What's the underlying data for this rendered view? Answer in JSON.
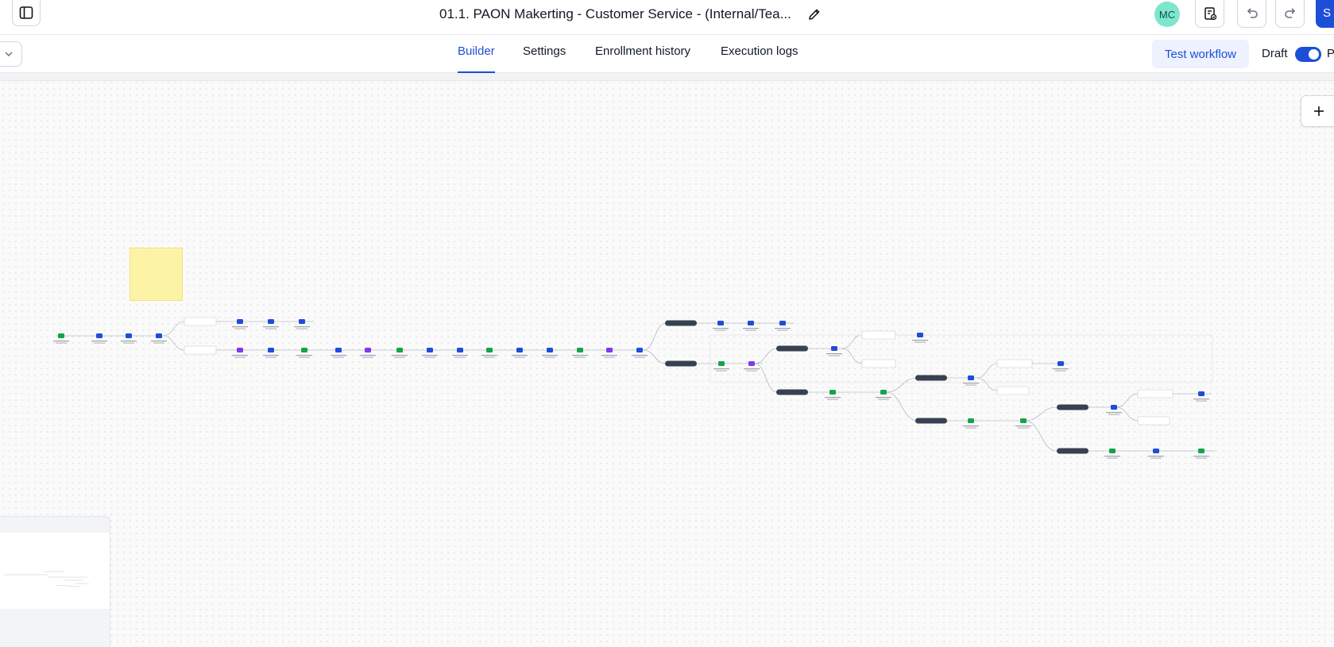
{
  "header": {
    "title": "01.1. PAON Makerting - Customer Service - (Internal/Tea...",
    "avatar_initials": "MC",
    "save_label": "S"
  },
  "tabs": [
    {
      "label": "Builder",
      "active": true
    },
    {
      "label": "Settings",
      "active": false
    },
    {
      "label": "Enrollment history",
      "active": false
    },
    {
      "label": "Execution logs",
      "active": false
    }
  ],
  "actions": {
    "test_workflow_label": "Test workflow",
    "draft_label": "Draft",
    "publish_label_partial": "P",
    "toggle_on": true
  },
  "colors": {
    "accent": "#1d4ed8",
    "avatar_bg": "#7ee6cf",
    "branch_pill": "#374151",
    "sticky_note": "#fdf3a7"
  },
  "icons": [
    "sidebar-toggle-icon",
    "pencil-icon",
    "clipboard-check-icon",
    "undo-icon",
    "redo-icon",
    "chevron-down-icon",
    "plus-icon"
  ]
}
